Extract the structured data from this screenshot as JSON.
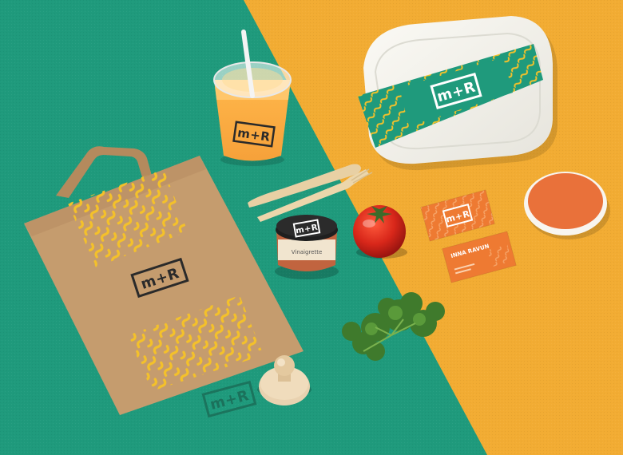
{
  "brand": {
    "logo_text": "m+R",
    "card_headline": "INNA RAVUN",
    "jar_label": "Vinaigrette"
  },
  "colors": {
    "green": "#1f9a7c",
    "green_dark": "#17836a",
    "orange_bg": "#f2ac33",
    "kraft": "#c59c6e",
    "kraft_dark": "#a77f55",
    "yellow_pattern": "#f4c12a",
    "card_orange": "#ee7a32",
    "coaster_orange": "#e9713a",
    "tomato": "#dc2a1c",
    "herb": "#3f7a2c",
    "white_box": "#f3f2ec"
  },
  "objects": [
    "juice-cup-icon",
    "paper-bag-icon",
    "wooden-cutlery-icon",
    "sauce-jar-icon",
    "tomato-icon",
    "parsley-icon",
    "rubber-stamp-icon",
    "food-box-icon",
    "business-cards-icon",
    "coaster-icon"
  ]
}
